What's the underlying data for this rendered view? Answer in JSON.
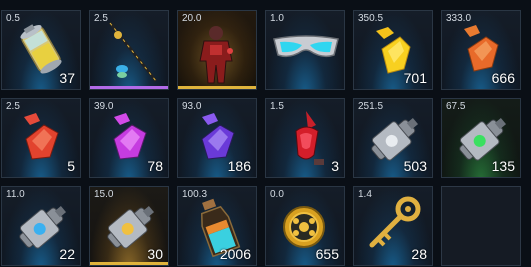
{
  "inventory": {
    "slots": [
      {
        "weight": "0.5",
        "qty": "37",
        "icon": "battery-cell-icon",
        "rarity": "common"
      },
      {
        "weight": "2.5",
        "qty": "",
        "icon": "fishing-rod-icon",
        "rarity": "epic",
        "bar_color": "#b26be8"
      },
      {
        "weight": "20.0",
        "qty": "",
        "icon": "red-armor-suit-icon",
        "rarity": "legendary",
        "bar_color": "#e0b43c"
      },
      {
        "weight": "1.0",
        "qty": "",
        "icon": "visor-goggles-icon",
        "rarity": "common"
      },
      {
        "weight": "350.5",
        "qty": "701",
        "icon": "yellow-crystal-icon",
        "rarity": "common"
      },
      {
        "weight": "333.0",
        "qty": "666",
        "icon": "orange-crystal-icon",
        "rarity": "common"
      },
      {
        "weight": "2.5",
        "qty": "5",
        "icon": "red-crystal-icon",
        "rarity": "common"
      },
      {
        "weight": "39.0",
        "qty": "78",
        "icon": "pink-crystal-icon",
        "rarity": "common"
      },
      {
        "weight": "93.0",
        "qty": "186",
        "icon": "purple-crystal-icon",
        "rarity": "common"
      },
      {
        "weight": "1.5",
        "qty": "3",
        "icon": "red-gem-pendant-icon",
        "rarity": "common"
      },
      {
        "weight": "251.5",
        "qty": "503",
        "icon": "ship-module-icon",
        "rarity": "common"
      },
      {
        "weight": "67.5",
        "qty": "135",
        "icon": "ship-module-green-icon",
        "rarity": "uncommon"
      },
      {
        "weight": "11.0",
        "qty": "22",
        "icon": "ship-module-blue-icon",
        "rarity": "common"
      },
      {
        "weight": "15.0",
        "qty": "30",
        "icon": "ship-module-gold-icon",
        "rarity": "legendary"
      },
      {
        "weight": "100.3",
        "qty": "2006",
        "icon": "potion-bottle-icon",
        "rarity": "common"
      },
      {
        "weight": "0.0",
        "qty": "655",
        "icon": "gold-coin-icon",
        "rarity": "common"
      },
      {
        "weight": "1.4",
        "qty": "28",
        "icon": "gold-key-icon",
        "rarity": "common"
      },
      {
        "weight": "",
        "qty": "",
        "icon": "empty-slot",
        "rarity": "none"
      }
    ]
  }
}
